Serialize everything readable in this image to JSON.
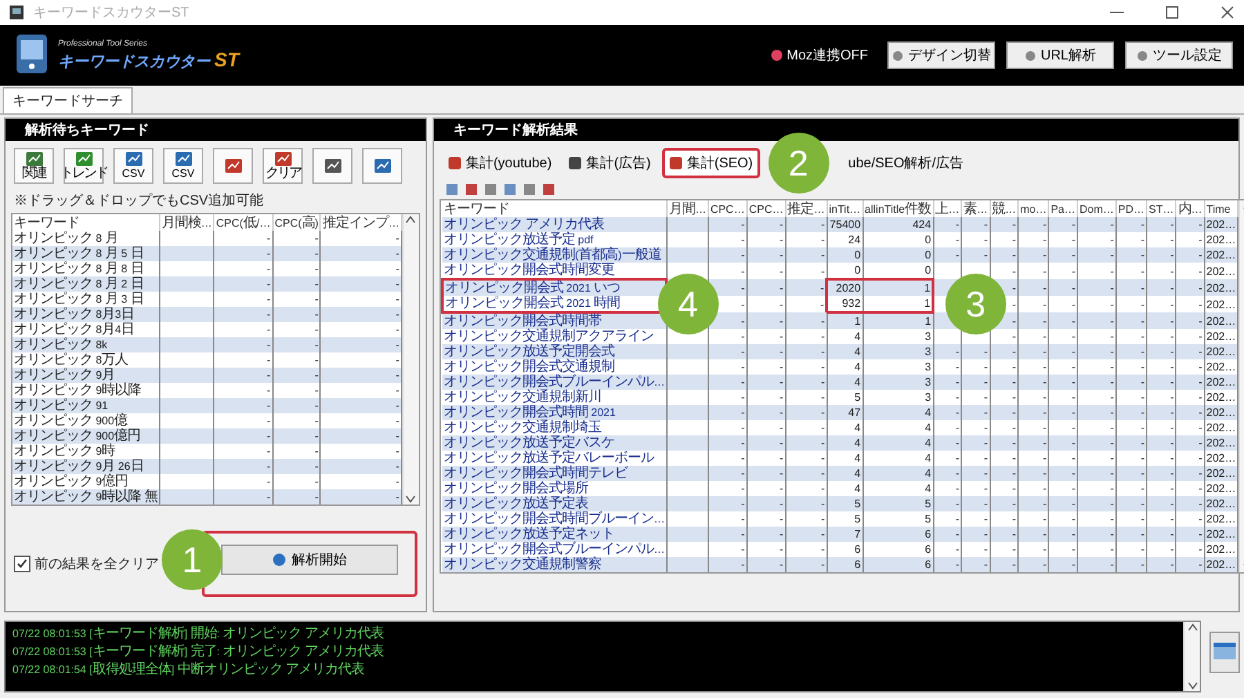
{
  "window": {
    "title": "キーワードスカウターST"
  },
  "header": {
    "logo_tagline": "Professional Tool Series",
    "logo_name": "キーワードスカウター",
    "logo_suffix": "ST",
    "status": "Moz連携OFF",
    "buttons": [
      "デザイン切替",
      "URL解析",
      "ツール設定"
    ]
  },
  "main_tab": {
    "label": "キーワードサーチ",
    "selected": true
  },
  "left_panel": {
    "title": "解析待ちキーワード",
    "tools": [
      {
        "kind": "labeled",
        "label": "関連"
      },
      {
        "kind": "labeled",
        "label": "トレンド"
      },
      {
        "kind": "labeled",
        "label": "CSV"
      },
      {
        "kind": "labeled",
        "label": "CSV"
      },
      {
        "kind": "icon"
      },
      {
        "kind": "labeled",
        "label": "クリア"
      },
      {
        "kind": "icon"
      },
      {
        "kind": "icon"
      }
    ],
    "note": "※ドラッグ＆ドロップでもCSV追加可能",
    "columns": [
      "キーワード",
      "月間検…",
      "CPC(低/…",
      "CPC(高)",
      "推定インプ…"
    ],
    "rows": [
      [
        "オリンピック 8 月",
        null,
        "-",
        "-",
        "-"
      ],
      [
        "オリンピック 8 月 5 日",
        null,
        "-",
        "-",
        "-"
      ],
      [
        "オリンピック 8 月 8 日",
        null,
        "-",
        "-",
        "-"
      ],
      [
        "オリンピック 8 月 2 日",
        null,
        "-",
        "-",
        "-"
      ],
      [
        "オリンピック 8 月 3 日",
        null,
        "-",
        "-",
        "-"
      ],
      [
        "オリンピック 8月3日",
        null,
        "-",
        "-",
        "-"
      ],
      [
        "オリンピック 8月4日",
        null,
        "-",
        "-",
        "-"
      ],
      [
        "オリンピック 8k",
        null,
        "-",
        "-",
        "-"
      ],
      [
        "オリンピック 8万人",
        null,
        "-",
        "-",
        "-"
      ],
      [
        "オリンピック 9月",
        null,
        "-",
        "-",
        "-"
      ],
      [
        "オリンピック 9時以降",
        null,
        "-",
        "-",
        "-"
      ],
      [
        "オリンピック 91",
        null,
        "-",
        "-",
        "-"
      ],
      [
        "オリンピック 900億",
        null,
        "-",
        "-",
        "-"
      ],
      [
        "オリンピック 900億円",
        null,
        "-",
        "-",
        "-"
      ],
      [
        "オリンピック 9時",
        null,
        "-",
        "-",
        "-"
      ],
      [
        "オリンピック 9月 26日",
        null,
        "-",
        "-",
        "-"
      ],
      [
        "オリンピック 9億円",
        null,
        "-",
        "-",
        "-"
      ],
      [
        "オリンピック 9時以降 無",
        null,
        "-",
        "-",
        "-"
      ]
    ],
    "clear_option": {
      "label": "前の結果を全クリア",
      "checked": true
    },
    "start_button": "解析開始"
  },
  "right_panel": {
    "title": "キーワード解析結果",
    "tabs": [
      {
        "label": "集計(youtube)",
        "selected": false
      },
      {
        "label": "集計(広告)",
        "selected": false
      },
      {
        "label": "集計(SEO)",
        "selected": true
      },
      {
        "label": "ube/SEO解析/広告",
        "selected": false
      }
    ],
    "columns": [
      "キーワード",
      "月間…",
      "CPC…",
      "CPC…",
      "推定…",
      "inTit…",
      "allinTitle件数",
      "上…",
      "素…",
      "競…",
      "mo…",
      "Pa…",
      "Dom…",
      "PD…",
      "ST…",
      "内…",
      "Time"
    ],
    "rows": [
      [
        "オリンピック アメリカ代表",
        null,
        "-",
        "-",
        "-",
        "75400",
        "424",
        "-",
        "-",
        "-",
        "-",
        "-",
        "-",
        "-",
        "-",
        "-",
        "202…"
      ],
      [
        "オリンピック放送予定 pdf",
        null,
        "-",
        "-",
        "-",
        "24",
        "0",
        "-",
        "-",
        "-",
        "-",
        "-",
        "-",
        "-",
        "-",
        "-",
        "202…"
      ],
      [
        "オリンピック交通規制(首都高)一般道",
        null,
        "-",
        "-",
        "-",
        "0",
        "0",
        "-",
        "-",
        "-",
        "-",
        "-",
        "-",
        "-",
        "-",
        "-",
        "202…"
      ],
      [
        "オリンピック開会式時間変更",
        null,
        "-",
        "-",
        "-",
        "0",
        "0",
        null,
        null,
        "-",
        "-",
        "-",
        "-",
        "-",
        "-",
        "-",
        "202…"
      ],
      [
        "オリンピック開会式 2021 いつ",
        null,
        "-",
        "-",
        "-",
        "2020",
        "1",
        null,
        null,
        "-",
        "-",
        "-",
        "-",
        "-",
        "-",
        "-",
        "202…"
      ],
      [
        "オリンピック開会式 2021 時間",
        null,
        "-",
        "-",
        "-",
        "932",
        "1",
        null,
        null,
        "-",
        "-",
        "-",
        "-",
        "-",
        "-",
        "-",
        "202…"
      ],
      [
        "オリンピック開会式時間帯",
        null,
        "-",
        "-",
        "-",
        "1",
        "1",
        null,
        null,
        "-",
        "-",
        "-",
        "-",
        "-",
        "-",
        "-",
        "202…"
      ],
      [
        "オリンピック交通規制アクアライン",
        null,
        "-",
        "-",
        "-",
        "4",
        "3",
        null,
        null,
        "-",
        "-",
        "-",
        "-",
        "-",
        "-",
        "-",
        "202…"
      ],
      [
        "オリンピック放送予定開会式",
        null,
        "-",
        "-",
        "-",
        "4",
        "3",
        "-",
        "-",
        "-",
        "-",
        "-",
        "-",
        "-",
        "-",
        "-",
        "202…"
      ],
      [
        "オリンピック開会式交通規制",
        null,
        "-",
        "-",
        "-",
        "4",
        "3",
        "-",
        "-",
        "-",
        "-",
        "-",
        "-",
        "-",
        "-",
        "-",
        "202…"
      ],
      [
        "オリンピック開会式ブルーインパル…",
        null,
        "-",
        "-",
        "-",
        "4",
        "3",
        "-",
        "-",
        "-",
        "-",
        "-",
        "-",
        "-",
        "-",
        "-",
        "202…"
      ],
      [
        "オリンピック交通規制新川",
        null,
        "-",
        "-",
        "-",
        "5",
        "3",
        "-",
        "-",
        "-",
        "-",
        "-",
        "-",
        "-",
        "-",
        "-",
        "202…"
      ],
      [
        "オリンピック開会式時間 2021",
        null,
        "-",
        "-",
        "-",
        "47",
        "4",
        "-",
        "-",
        "-",
        "-",
        "-",
        "-",
        "-",
        "-",
        "-",
        "202…"
      ],
      [
        "オリンピック交通規制埼玉",
        null,
        "-",
        "-",
        "-",
        "4",
        "4",
        "-",
        "-",
        "-",
        "-",
        "-",
        "-",
        "-",
        "-",
        "-",
        "202…"
      ],
      [
        "オリンピック放送予定バスケ",
        null,
        "-",
        "-",
        "-",
        "4",
        "4",
        "-",
        "-",
        "-",
        "-",
        "-",
        "-",
        "-",
        "-",
        "-",
        "202…"
      ],
      [
        "オリンピック放送予定バレーボール",
        null,
        "-",
        "-",
        "-",
        "4",
        "4",
        "-",
        "-",
        "-",
        "-",
        "-",
        "-",
        "-",
        "-",
        "-",
        "202…"
      ],
      [
        "オリンピック開会式時間テレビ",
        null,
        "-",
        "-",
        "-",
        "4",
        "4",
        "-",
        "-",
        "-",
        "-",
        "-",
        "-",
        "-",
        "-",
        "-",
        "202…"
      ],
      [
        "オリンピック開会式場所",
        null,
        "-",
        "-",
        "-",
        "4",
        "4",
        "-",
        "-",
        "-",
        "-",
        "-",
        "-",
        "-",
        "-",
        "-",
        "202…"
      ],
      [
        "オリンピック放送予定表",
        null,
        "-",
        "-",
        "-",
        "5",
        "5",
        "-",
        "-",
        "-",
        "-",
        "-",
        "-",
        "-",
        "-",
        "-",
        "202…"
      ],
      [
        "オリンピック開会式時間ブルーイン…",
        null,
        "-",
        "-",
        "-",
        "5",
        "5",
        "-",
        "-",
        "-",
        "-",
        "-",
        "-",
        "-",
        "-",
        "-",
        "202…"
      ],
      [
        "オリンピック放送予定ネット",
        null,
        "-",
        "-",
        "-",
        "7",
        "6",
        "-",
        "-",
        "-",
        "-",
        "-",
        "-",
        "-",
        "-",
        "-",
        "202…"
      ],
      [
        "オリンピック開会式ブルーインパル…",
        null,
        "-",
        "-",
        "-",
        "6",
        "6",
        "-",
        "-",
        "-",
        "-",
        "-",
        "-",
        "-",
        "-",
        "-",
        "202…"
      ],
      [
        "オリンピック交通規制警察",
        null,
        "-",
        "-",
        "-",
        "6",
        "6",
        "-",
        "-",
        "-",
        "-",
        "-",
        "-",
        "-",
        "-",
        "-",
        "202…"
      ]
    ]
  },
  "log": [
    "07/22 08:01:53 [キーワード解析] 開始: オリンピック アメリカ代表",
    "07/22 08:01:53 [キーワード解析] 完了: オリンピック アメリカ代表",
    "07/22 08:01:54 [取得処理全体] 中断オリンピック アメリカ代表"
  ],
  "annotations": [
    {
      "number": "1"
    },
    {
      "number": "2"
    },
    {
      "number": "3"
    },
    {
      "number": "4"
    }
  ]
}
